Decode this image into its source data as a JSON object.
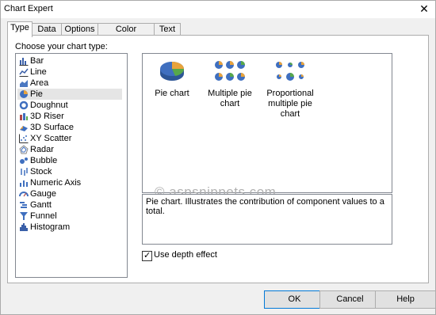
{
  "window": {
    "title": "Chart Expert",
    "close_glyph": "✕"
  },
  "tabs": [
    {
      "label": "Type",
      "active": true
    },
    {
      "label": "Data",
      "active": false
    },
    {
      "label": "Options",
      "active": false
    },
    {
      "label": "Color Highlight",
      "active": false
    },
    {
      "label": "Text",
      "active": false
    }
  ],
  "type_panel": {
    "choose_label": "Choose your chart type:",
    "chart_types": [
      {
        "label": "Bar",
        "icon": "bar-chart-icon"
      },
      {
        "label": "Line",
        "icon": "line-chart-icon"
      },
      {
        "label": "Area",
        "icon": "area-chart-icon"
      },
      {
        "label": "Pie",
        "icon": "pie-chart-icon",
        "selected": true
      },
      {
        "label": "Doughnut",
        "icon": "doughnut-chart-icon"
      },
      {
        "label": "3D Riser",
        "icon": "3d-riser-icon"
      },
      {
        "label": "3D Surface",
        "icon": "3d-surface-icon"
      },
      {
        "label": "XY Scatter",
        "icon": "xy-scatter-icon"
      },
      {
        "label": "Radar",
        "icon": "radar-chart-icon"
      },
      {
        "label": "Bubble",
        "icon": "bubble-chart-icon"
      },
      {
        "label": "Stock",
        "icon": "stock-chart-icon"
      },
      {
        "label": "Numeric Axis",
        "icon": "numeric-axis-icon"
      },
      {
        "label": "Gauge",
        "icon": "gauge-chart-icon"
      },
      {
        "label": "Gantt",
        "icon": "gantt-chart-icon"
      },
      {
        "label": "Funnel",
        "icon": "funnel-chart-icon"
      },
      {
        "label": "Histogram",
        "icon": "histogram-chart-icon"
      }
    ],
    "subtypes": {
      "pie": "Pie chart",
      "multiple_line1": "Multiple pie chart",
      "proportional_line1": "Proportional",
      "proportional_line2": "multiple pie chart"
    },
    "watermark": "© aspsnippets.com",
    "description": "Pie chart. Illustrates the contribution of component values to a total.",
    "depth_effect": {
      "label": "Use depth effect",
      "checked": true,
      "check_glyph": "✓"
    }
  },
  "buttons": {
    "ok": "OK",
    "cancel": "Cancel",
    "help": "Help"
  },
  "colors": {
    "pie_blue": "#3f6fbf",
    "pie_orange": "#e8a33c",
    "pie_green": "#57a84a",
    "accent": "#0078d7"
  }
}
